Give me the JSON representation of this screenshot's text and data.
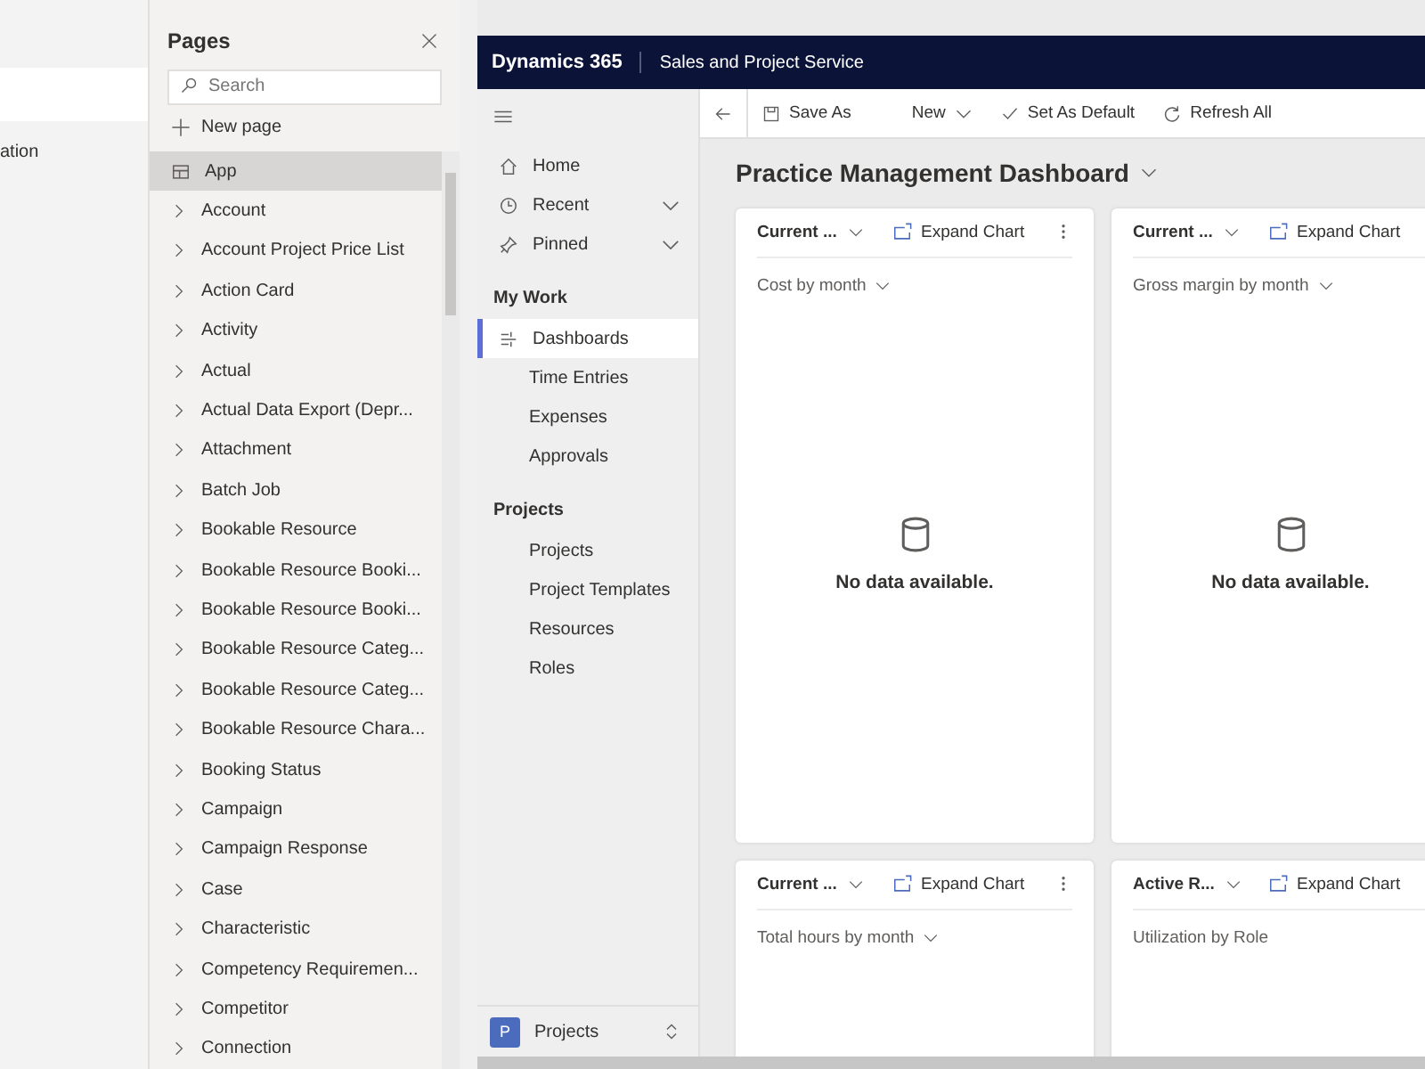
{
  "left_panel": {
    "fragment": "ation"
  },
  "pages_panel": {
    "title": "Pages",
    "search": {
      "placeholder": "Search"
    },
    "new_page": "New page",
    "items": [
      {
        "kind": "app",
        "label": "App",
        "selected": true
      },
      {
        "kind": "entity",
        "label": "Account",
        "selected": false
      },
      {
        "kind": "entity",
        "label": "Account Project Price List",
        "selected": false
      },
      {
        "kind": "entity",
        "label": "Action Card",
        "selected": false
      },
      {
        "kind": "entity",
        "label": "Activity",
        "selected": false
      },
      {
        "kind": "entity",
        "label": "Actual",
        "selected": false
      },
      {
        "kind": "entity",
        "label": "Actual Data Export (Depr...",
        "selected": false
      },
      {
        "kind": "entity",
        "label": "Attachment",
        "selected": false
      },
      {
        "kind": "entity",
        "label": "Batch Job",
        "selected": false
      },
      {
        "kind": "entity",
        "label": "Bookable Resource",
        "selected": false
      },
      {
        "kind": "entity",
        "label": "Bookable Resource Booki...",
        "selected": false
      },
      {
        "kind": "entity",
        "label": "Bookable Resource Booki...",
        "selected": false
      },
      {
        "kind": "entity",
        "label": "Bookable Resource Categ...",
        "selected": false
      },
      {
        "kind": "entity",
        "label": "Bookable Resource Categ...",
        "selected": false
      },
      {
        "kind": "entity",
        "label": "Bookable Resource Chara...",
        "selected": false
      },
      {
        "kind": "entity",
        "label": "Booking Status",
        "selected": false
      },
      {
        "kind": "entity",
        "label": "Campaign",
        "selected": false
      },
      {
        "kind": "entity",
        "label": "Campaign Response",
        "selected": false
      },
      {
        "kind": "entity",
        "label": "Case",
        "selected": false
      },
      {
        "kind": "entity",
        "label": "Characteristic",
        "selected": false
      },
      {
        "kind": "entity",
        "label": "Competency Requiremen...",
        "selected": false
      },
      {
        "kind": "entity",
        "label": "Competitor",
        "selected": false
      },
      {
        "kind": "entity",
        "label": "Connection",
        "selected": false
      }
    ]
  },
  "app": {
    "brand": "Dynamics 365",
    "app_name": "Sales and Project Service"
  },
  "nav": {
    "items": [
      {
        "kind": "home",
        "label": "Home",
        "expandable": false
      },
      {
        "kind": "recent",
        "label": "Recent",
        "expandable": true
      },
      {
        "kind": "pinned",
        "label": "Pinned",
        "expandable": true
      }
    ],
    "sections": [
      {
        "title": "My Work",
        "items": [
          {
            "kind": "dashboards",
            "label": "Dashboards",
            "selected": true
          },
          {
            "kind": "plain",
            "label": "Time Entries",
            "selected": false
          },
          {
            "kind": "plain",
            "label": "Expenses",
            "selected": false
          },
          {
            "kind": "plain",
            "label": "Approvals",
            "selected": false
          }
        ]
      },
      {
        "title": "Projects",
        "items": [
          {
            "kind": "plain",
            "label": "Projects",
            "selected": false
          },
          {
            "kind": "plain",
            "label": "Project Templates",
            "selected": false
          },
          {
            "kind": "plain",
            "label": "Resources",
            "selected": false
          },
          {
            "kind": "plain",
            "label": "Roles",
            "selected": false
          }
        ]
      }
    ],
    "area": {
      "badge": "P",
      "label": "Projects"
    }
  },
  "toolbar": {
    "buttons": [
      {
        "kind": "save",
        "label": "Save As"
      },
      {
        "kind": "new",
        "label": "New"
      },
      {
        "kind": "check",
        "label": "Set As Default"
      },
      {
        "kind": "refresh",
        "label": "Refresh All"
      }
    ]
  },
  "dashboard": {
    "title": "Practice Management Dashboard",
    "cards": [
      {
        "view": "Current ...",
        "expand": "Expand Chart",
        "has_menu": true,
        "chart_title": "Cost by month",
        "chart_dropdown": true,
        "message": "No data available."
      },
      {
        "view": "Current ...",
        "expand": "Expand Chart",
        "has_menu": false,
        "chart_title": "Gross margin by month",
        "chart_dropdown": true,
        "message": "No data available."
      },
      {
        "view": "Current ...",
        "expand": "Expand Chart",
        "has_menu": true,
        "chart_title": "Total hours by month",
        "chart_dropdown": true
      },
      {
        "view": "Active R...",
        "expand": "Expand Chart",
        "has_menu": false,
        "chart_title": "Utilization by Role",
        "chart_dropdown": false
      }
    ]
  }
}
